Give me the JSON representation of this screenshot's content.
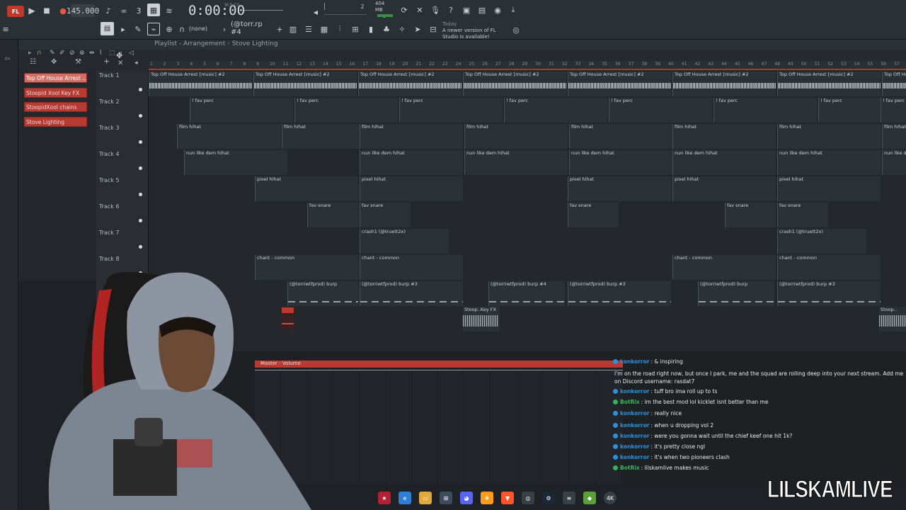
{
  "toolbar": {
    "logo": "FL",
    "tempo": "145.000",
    "time": "0:00:00",
    "time_unit": "M:S:CS",
    "pitch_value": "2",
    "memory_mb": "404 MB",
    "memory_sub": "0",
    "snap_none": "(none)",
    "pattern": "(@torr.rp #4",
    "news_today": "Today",
    "news_text": "A newer version of FL Studio is available!"
  },
  "playlist": {
    "title": "Playlist - Arrangement",
    "arrangement": "Stove Lighting",
    "ruler": [
      "1",
      "2",
      "3",
      "4",
      "5",
      "6",
      "7",
      "8",
      "9",
      "10",
      "11",
      "12",
      "13",
      "14",
      "15",
      "16",
      "17",
      "18",
      "19",
      "20",
      "21",
      "22",
      "23",
      "24",
      "25",
      "26",
      "27",
      "28",
      "29",
      "30",
      "31",
      "32",
      "33",
      "34",
      "35",
      "36",
      "37",
      "38",
      "39",
      "40",
      "41",
      "42",
      "43",
      "44",
      "45",
      "46",
      "47",
      "48",
      "49",
      "50",
      "51",
      "52",
      "53",
      "54",
      "55",
      "56",
      "57"
    ]
  },
  "picker": [
    {
      "label": "Top Off  House Arrest ..."
    },
    {
      "label": "Stoopid Xool Key FX"
    },
    {
      "label": "StoopidXool chains"
    },
    {
      "label": "Stove Lighting"
    }
  ],
  "tracks": [
    {
      "label": "Track 1"
    },
    {
      "label": "Track 2"
    },
    {
      "label": "Track 3"
    },
    {
      "label": "Track 4"
    },
    {
      "label": "Track 5"
    },
    {
      "label": "Track 6"
    },
    {
      "label": "Track 7"
    },
    {
      "label": "Track 8"
    }
  ],
  "clip_names": {
    "t1": "Top Off  House Arrest [music] #2",
    "t2": "! fav perc",
    "t3": "film hihat",
    "t4": "nun like dem hihat",
    "t5": "pixel hihat",
    "t6": "fav snare",
    "t7": "crash1 (@truett2x)",
    "t8": "chant - common",
    "t9a": "(@torriwtfprod) burp",
    "t9b": "(@torriwtfprod) burp #3",
    "t9c": "(@torriwtfprod) burp #4",
    "fx": "Stoop..Key FX",
    "fx_end": "Stoop.."
  },
  "master": {
    "label": "Master - Volume"
  },
  "chat": [
    {
      "user": "konkorror",
      "text": ": & inspiring",
      "color": "#2f8fd8"
    },
    {
      "user": "",
      "text": "I'm on the road right now, but once I park, me and the squad are rolling deep into your next stream. Add me on Discord username: rasdat7",
      "color": "#9b59b6"
    },
    {
      "user": "konkorror",
      "text": ": tuff bro ima roll up to ts",
      "color": "#2f8fd8"
    },
    {
      "user": "BotRix",
      "text": ": im the best mod lol kicklet isnt better than me",
      "color": "#36b35a"
    },
    {
      "user": "konkorror",
      "text": ": really nice",
      "color": "#2f8fd8"
    },
    {
      "user": "konkorror",
      "text": ": when u dropping vol 2",
      "color": "#2f8fd8"
    },
    {
      "user": "konkorror",
      "text": ": were you gonna wait until the chief keef one hit 1k?",
      "color": "#2f8fd8"
    },
    {
      "user": "konkorror",
      "text": ": it's pretty close ngl",
      "color": "#2f8fd8"
    },
    {
      "user": "konkorror",
      "text": ": it's when two pioneers clash",
      "color": "#2f8fd8"
    },
    {
      "user": "BotRix",
      "text": ": lilskamlive makes music",
      "color": "#36b35a"
    }
  ],
  "watermark": "LILSKAMLIVE"
}
